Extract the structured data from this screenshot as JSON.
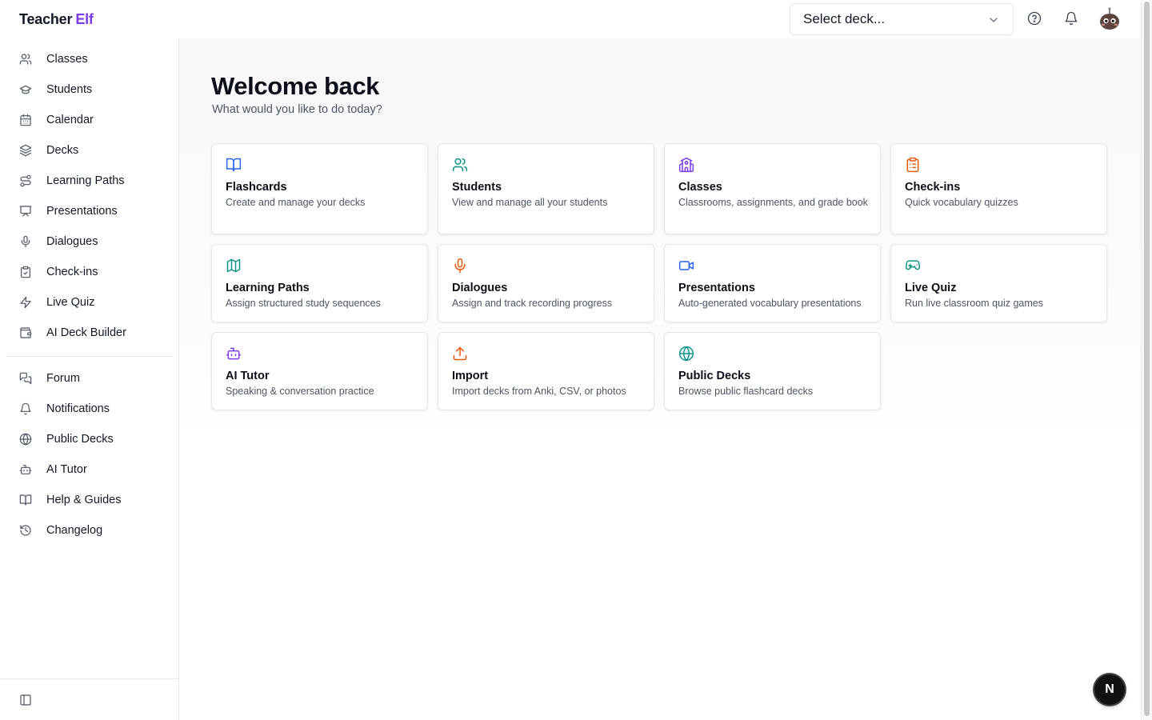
{
  "brand": {
    "part1": "Teacher",
    "part2": "Elf",
    "accent": "#7c3aed"
  },
  "header": {
    "deck_select": {
      "value": "Select deck...",
      "icon": "chevron-down-icon"
    },
    "help_icon": "help-circle-icon",
    "bell_icon": "bell-icon",
    "avatar_icon": "avatar"
  },
  "sidebar": {
    "items": [
      {
        "label": "Classes",
        "icon": "users-icon"
      },
      {
        "label": "Students",
        "icon": "graduation-cap-icon"
      },
      {
        "label": "Calendar",
        "icon": "calendar-icon"
      },
      {
        "label": "Decks",
        "icon": "layers-icon"
      },
      {
        "label": "Learning Paths",
        "icon": "route-icon"
      },
      {
        "label": "Presentations",
        "icon": "presentation-icon"
      },
      {
        "label": "Dialogues",
        "icon": "mic-icon"
      },
      {
        "label": "Check-ins",
        "icon": "clipboard-check-icon"
      },
      {
        "label": "Live Quiz",
        "icon": "zap-icon"
      },
      {
        "label": "AI Deck Builder",
        "icon": "wallet-icon"
      }
    ],
    "secondary": [
      {
        "label": "Forum",
        "icon": "message-square-icon"
      },
      {
        "label": "Notifications",
        "icon": "bell-icon"
      },
      {
        "label": "Public Decks",
        "icon": "globe-icon"
      },
      {
        "label": "AI Tutor",
        "icon": "bot-icon"
      },
      {
        "label": "Help & Guides",
        "icon": "book-open-icon"
      },
      {
        "label": "Changelog",
        "icon": "history-icon"
      }
    ],
    "collapse_icon": "panel-left-icon"
  },
  "main": {
    "title": "Welcome back",
    "subtitle": "What would you like to do today?",
    "cards": [
      {
        "title": "Flashcards",
        "desc": "Create and manage your decks",
        "icon": "book-open-icon",
        "color": "#2563eb"
      },
      {
        "title": "Students",
        "desc": "View and manage all your students",
        "icon": "users-icon",
        "color": "#0d9488"
      },
      {
        "title": "Classes",
        "desc": "Classrooms, assignments, and grade book",
        "icon": "school-icon",
        "color": "#7c3aed"
      },
      {
        "title": "Check-ins",
        "desc": "Quick vocabulary quizzes",
        "icon": "clipboard-list-icon",
        "color": "#ea580c"
      },
      {
        "title": "Learning Paths",
        "desc": "Assign structured study sequences",
        "icon": "map-icon",
        "color": "#0d9488"
      },
      {
        "title": "Dialogues",
        "desc": "Assign and track recording progress",
        "icon": "mic-icon",
        "color": "#ea580c"
      },
      {
        "title": "Presentations",
        "desc": "Auto-generated vocabulary presentations",
        "icon": "video-icon",
        "color": "#2563eb"
      },
      {
        "title": "Live Quiz",
        "desc": "Run live classroom quiz games",
        "icon": "gamepad-icon",
        "color": "#0d9488"
      },
      {
        "title": "AI Tutor",
        "desc": "Speaking & conversation practice",
        "icon": "bot-icon",
        "color": "#7c3aed"
      },
      {
        "title": "Import",
        "desc": "Import decks from Anki, CSV, or photos",
        "icon": "upload-icon",
        "color": "#ea580c"
      },
      {
        "title": "Public Decks",
        "desc": "Browse public flashcard decks",
        "icon": "globe-icon",
        "color": "#0d9488"
      }
    ]
  },
  "fab": {
    "label": "N"
  }
}
